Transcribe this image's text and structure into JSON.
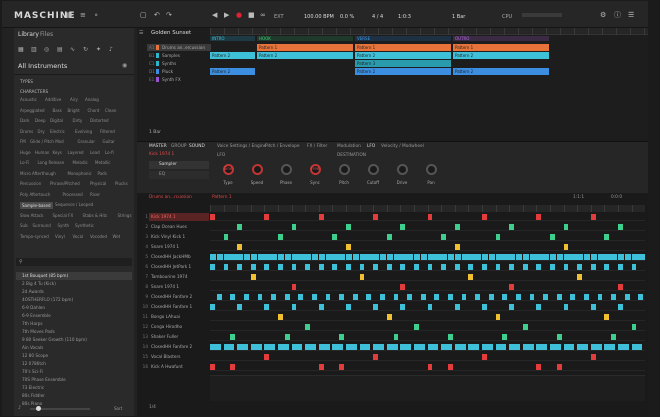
{
  "app": {
    "logo": "MASCHINE",
    "tempo": "100.00 BPM",
    "swing": "0.0 %",
    "signature": "4 / 4",
    "position": "1:0:3",
    "grid": "1 Bar",
    "cpu_label": "CPU",
    "ext_label": "EXT",
    "rec_label": "REC"
  },
  "library": {
    "tab_library": "Library",
    "tab_files": "Files",
    "section": "All Instruments",
    "types": "TYPES",
    "characters": "CHARACTERS",
    "chips": [
      [
        "Acoustic",
        "Additive",
        "Airy",
        "Analog"
      ],
      [
        "Arpeggiated",
        "Bass",
        "Bright",
        "Chord",
        "Clean"
      ],
      [
        "Dark",
        "Deep",
        "Digital",
        "Dirty",
        "Distorted"
      ],
      [
        "Drums",
        "Dry",
        "Electric",
        "Evolving",
        "Filtered"
      ],
      [
        "FM",
        "Glide / Pitch Mod",
        "Granular",
        "Guitar"
      ],
      [
        "Huge",
        "Human",
        "Keys",
        "Layered",
        "Lead",
        "Lo-fi"
      ],
      [
        "Lo-Fi",
        "Long Release",
        "Melodic",
        "Metallic"
      ],
      [
        "Micro Afterthough",
        "Monophonic",
        "Pads"
      ],
      [
        "Percussion",
        "Phrase/Pitched",
        "Physical",
        "Plucks"
      ],
      [
        "Poly Aftertouch",
        "Processed",
        "Riser"
      ],
      [
        "Sample-based",
        "Sequence / Looped"
      ],
      [
        "Slow Attack",
        "Special FX",
        "Stabs & Hits",
        "Strings"
      ],
      [
        "Sub",
        "Surround",
        "Synth",
        "Synthetic"
      ],
      [
        "Tempo-synced",
        "Vinyl",
        "Vocal",
        "Vocoded",
        "Wet"
      ]
    ],
    "results": [
      "1st Bouquet (85 bpm)",
      "2 Big 4 Tu (Kick)",
      "2d Awards",
      "4OSTHERFLO (172 bpm)",
      "6-9 Dahlen",
      "6-9 Ensemble",
      "7th Harps",
      "7th Moves Pads",
      "9 80 Seeker Growth (110 bpm)",
      "Ain Vocals",
      "12 80 Scope",
      "12 0786tch",
      "70's Sci-Fi",
      "70S Phase Ensemble",
      "73 Electric",
      "80s Fiddler",
      "80s Piano"
    ],
    "footer_count": "Sort"
  },
  "arranger": {
    "project": "Golden Sunset",
    "bar_label": "1 Bar",
    "tracks": [
      {
        "id": "A1",
        "name": "Drums an..ercussion",
        "color": "#e8733a"
      },
      {
        "id": "B1",
        "name": "Samples",
        "color": "#2fb5c9"
      },
      {
        "id": "C1",
        "name": "Synths",
        "color": "#2fb5c9"
      },
      {
        "id": "D1",
        "name": "Pluck",
        "color": "#3c8fe0"
      },
      {
        "id": "E1",
        "name": "Synth FX",
        "color": "#9a53d0"
      }
    ],
    "sections": [
      "INTRO",
      "HOOK",
      "VERSE",
      "OUTRO"
    ],
    "clip_label": "Pattern 1",
    "clip_label2": "Pattern 2",
    "clip_label3": "Pattern 3"
  },
  "controls": {
    "tabs": [
      "MASTER",
      "GROUP",
      "SOUND"
    ],
    "subtabs": [
      "Voice Settings / Engine",
      "Pitch / Envelope",
      "FX / Filter",
      "Modulation",
      "LFO",
      "Velocity / Modwheel"
    ],
    "sound_name": "Kick 1974 1",
    "plugin": "Sampler",
    "slot2": "EQ",
    "lfo_label": "LFO",
    "dest_label": "DESTINATION",
    "knobs": [
      "Type",
      "Speed",
      "Phase",
      "Sync",
      "Pitch",
      "Cutoff",
      "Drive",
      "Pan"
    ],
    "knob_vals": [
      "Sine",
      "",
      "",
      "Free",
      "",
      "",
      "",
      ""
    ]
  },
  "piano": {
    "group": "Drums an...rcussion",
    "pattern": "Pattern 1",
    "length": "1:1:1",
    "start": "0:0:0",
    "sounds": [
      "Kick 1974 1",
      "Clap Ocean Hues",
      "Kick Vinyl Kick 1",
      "Snare 1974 1",
      "ClosedHH JackHMb",
      "ClosedHH JetPark 1",
      "Tambourine 1974",
      "Snare 1974 1",
      "ClosedHH Fanfare 2",
      "ClosedHH Fanfare 1",
      "Bongo LAhuai",
      "Conga Hirodho",
      "Shaker Fuller",
      "ClosedHH Fanfare 2",
      "Vocal Blasters",
      "Kick A Hwafunt"
    ],
    "footer": "1/4"
  }
}
